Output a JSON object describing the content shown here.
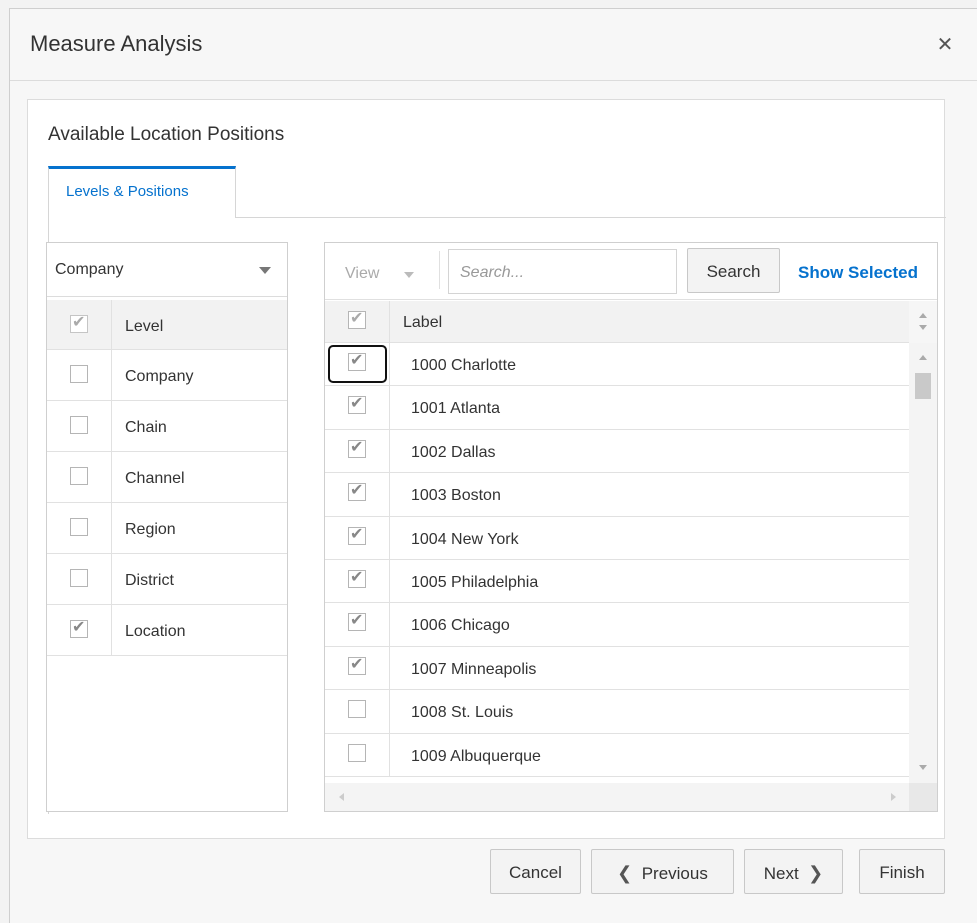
{
  "dialog": {
    "title": "Measure Analysis"
  },
  "section": {
    "title": "Available Location Positions",
    "tab_label": "Levels & Positions"
  },
  "levels": {
    "dropdown_value": "Company",
    "header_label": "Level",
    "items": [
      {
        "label": "Company",
        "checked": false
      },
      {
        "label": "Chain",
        "checked": false
      },
      {
        "label": "Channel",
        "checked": false
      },
      {
        "label": "Region",
        "checked": false
      },
      {
        "label": "District",
        "checked": false
      },
      {
        "label": "Location",
        "checked": true
      }
    ]
  },
  "positions": {
    "view_label": "View",
    "search_placeholder": "Search...",
    "search_button": "Search",
    "show_selected": "Show Selected",
    "header_label": "Label",
    "rows": [
      {
        "label": "1000 Charlotte",
        "checked": true
      },
      {
        "label": "1001 Atlanta",
        "checked": true
      },
      {
        "label": "1002 Dallas",
        "checked": true
      },
      {
        "label": "1003 Boston",
        "checked": true
      },
      {
        "label": "1004 New York",
        "checked": true
      },
      {
        "label": "1005 Philadelphia",
        "checked": true
      },
      {
        "label": "1006 Chicago",
        "checked": true
      },
      {
        "label": "1007 Minneapolis",
        "checked": true
      },
      {
        "label": "1008 St. Louis",
        "checked": false
      },
      {
        "label": "1009 Albuquerque",
        "checked": false
      }
    ]
  },
  "footer": {
    "cancel": "Cancel",
    "previous": "Previous",
    "next": "Next",
    "finish": "Finish"
  },
  "icons": {
    "close": "close-icon",
    "dropdown": "chevron-down-icon",
    "check": "checkmark-icon"
  },
  "colors": {
    "accent": "#0572ce",
    "border": "#cfcfcf"
  }
}
